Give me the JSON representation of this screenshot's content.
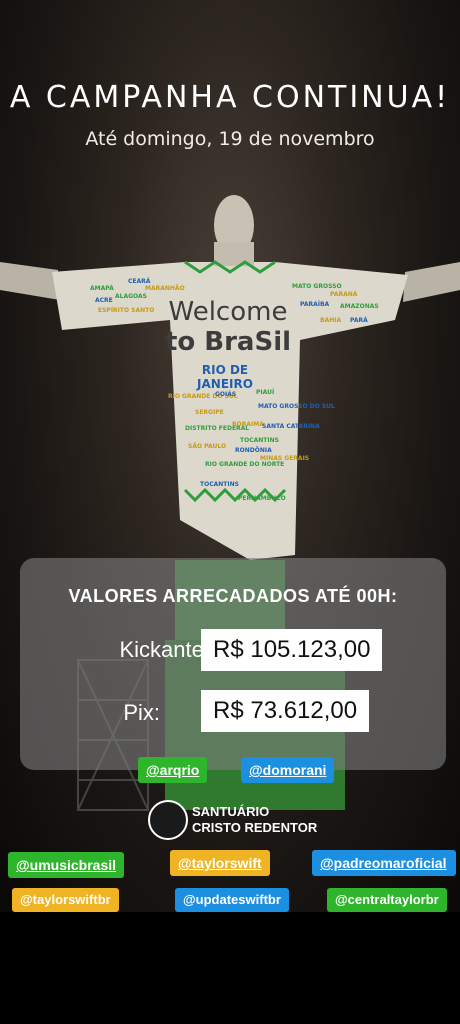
{
  "header": {
    "title": "A CAMPANHA CONTINUA!",
    "subtitle": "Até domingo, 19 de novembro"
  },
  "panel": {
    "title": "VALORES ARRECADADOS ATÉ 00H:",
    "rows": [
      {
        "label": "Kickante:",
        "value": "R$ 105.123,00"
      },
      {
        "label": "Pix:",
        "value": "R$ 73.612,00"
      }
    ]
  },
  "statue": {
    "welcome": "Welcome",
    "to_brasil": "to BraSil",
    "rio": "RIO DE",
    "janeiro": "JANEIRO",
    "states_left": [
      "CEARÁ",
      "AMAPÁ",
      "MARANHÃO",
      "ACRE",
      "ALAGOAS",
      "ESPÍRITO SANTO"
    ],
    "states_right": [
      "MATO GROSSO",
      "PARANÁ",
      "PARAÍBA",
      "AMAZONAS",
      "BAHIA",
      "PARÁ"
    ],
    "states_body": [
      "RIO GRANDE DO SUL",
      "GOIÁS",
      "PIAUÍ",
      "SERGIPE",
      "MATO GROSSO DO SUL",
      "DISTRITO FEDERAL",
      "RORAIMA",
      "SANTA CATARINA",
      "TOCANTINS",
      "SÃO PAULO",
      "RONDÔNIA",
      "RIO GRANDE DO NORTE",
      "MINAS GERAIS",
      "TOCANTINS",
      "PERNAMBUCO"
    ]
  },
  "tags_row1": [
    "@arqrio",
    "@domorani"
  ],
  "logo": {
    "line1": "SANTUÁRIO",
    "line2": "CRISTO REDENTOR"
  },
  "tags_row2": [
    "@umusicbrasil",
    "@taylorswift",
    "@padreomaroficial"
  ],
  "tags_row3": [
    "@taylorswiftbr",
    "@updateswiftbr",
    "@centraltaylorbr"
  ],
  "colors": {
    "tag_green": "#2fb52c",
    "tag_blue": "#1d8fe0",
    "tag_yellow": "#f0b323",
    "panel": "#7d7d7d"
  }
}
